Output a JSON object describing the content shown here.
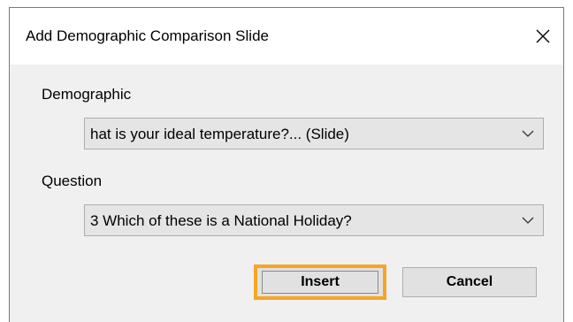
{
  "dialog": {
    "title": "Add Demographic Comparison Slide",
    "close_icon": "close-icon"
  },
  "demographic": {
    "label": "Demographic",
    "value": "hat is your ideal temperature?... (Slide)",
    "dropdown_icon": "chevron-down-icon"
  },
  "question": {
    "label": "Question",
    "value": "3 Which of these is a National Holiday?",
    "dropdown_icon": "chevron-down-icon"
  },
  "buttons": {
    "insert_label": "Insert",
    "cancel_label": "Cancel"
  },
  "colors": {
    "focus_highlight": "#f5a623",
    "dialog_background": "#f0f0f0",
    "titlebar_background": "#ffffff"
  }
}
